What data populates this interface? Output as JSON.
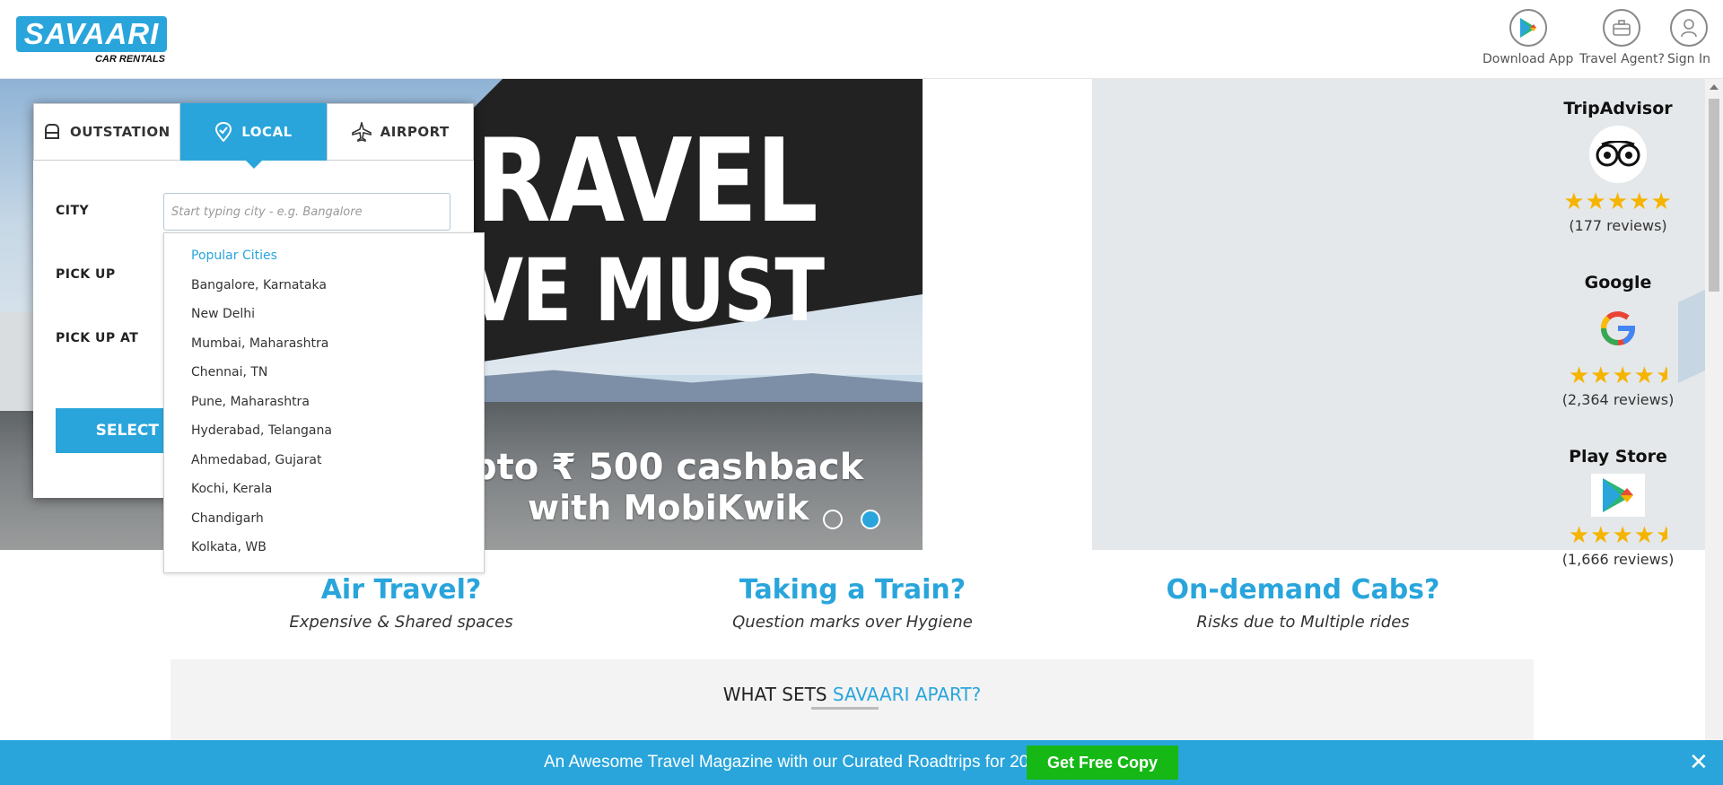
{
  "header": {
    "logo_text": "SAVAARI",
    "logo_sub": "CAR RENTALS",
    "download_app": "Download App",
    "travel_agent": "Travel Agent?",
    "sign_in": "Sign In"
  },
  "hero": {
    "headline_1": "RAVEL",
    "headline_2": "VE MUST",
    "cashback_1": "pto ₹ 500 cashback",
    "cashback_2": "with MobiKwik",
    "slide_count": 2,
    "active_slide": 2
  },
  "booking": {
    "tabs": [
      {
        "label": "OUTSTATION",
        "icon": "car-icon"
      },
      {
        "label": "LOCAL",
        "icon": "location-pin-icon",
        "active": true
      },
      {
        "label": "AIRPORT",
        "icon": "airplane-icon"
      }
    ],
    "city_label": "CITY",
    "city_placeholder": "Start typing city - e.g. Bangalore",
    "pickup_label": "PICK UP",
    "pickup_at_label": "PICK UP AT",
    "select_button": "SELECT"
  },
  "city_dropdown": {
    "heading": "Popular Cities",
    "items": [
      "Bangalore, Karnataka",
      "New Delhi",
      "Mumbai, Maharashtra",
      "Chennai, TN",
      "Pune, Maharashtra",
      "Hyderabad, Telangana",
      "Ahmedabad, Gujarat",
      "Kochi, Kerala",
      "Chandigarh",
      "Kolkata, WB"
    ]
  },
  "ratings": [
    {
      "title": "TripAdvisor",
      "icon": "tripadvisor-owl-icon",
      "stars": 5,
      "reviews": "(177 reviews)"
    },
    {
      "title": "Google",
      "icon": "google-g-icon",
      "stars": 4.5,
      "reviews": "(2,364 reviews)"
    },
    {
      "title": "Play Store",
      "icon": "play-store-icon",
      "stars": 4.5,
      "reviews": "(1,666 reviews)"
    }
  ],
  "problems": [
    {
      "title": "Air Travel?",
      "subtitle": "Expensive & Shared spaces"
    },
    {
      "title": "Taking a Train?",
      "subtitle": "Question marks over Hygiene"
    },
    {
      "title": "On-demand Cabs?",
      "subtitle": "Risks due to Multiple rides"
    }
  ],
  "apart": {
    "prefix": "WHAT SETS ",
    "highlight": "SAVAARI APART?"
  },
  "promo_bar": {
    "text": "An Awesome Travel Magazine with our Curated Roadtrips for 2022",
    "button": "Get Free Copy",
    "close": "✕"
  },
  "colors": {
    "brand_blue": "#29a5dc",
    "cta_green": "#16b816",
    "star_gold": "#f5b400"
  }
}
